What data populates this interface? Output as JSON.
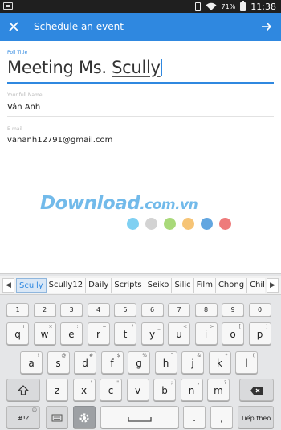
{
  "status_bar": {
    "battery_percent": "71%",
    "time": "11:38"
  },
  "app_bar": {
    "title": "Schedule an event",
    "close_icon": "close-icon",
    "next_icon": "arrow-right-icon"
  },
  "form": {
    "poll_title": {
      "label": "Poll Title",
      "value_prefix": "Meeting Ms. ",
      "value_underlined": "Scully"
    },
    "full_name": {
      "label": "Your full Name",
      "value": "Vân Anh"
    },
    "email": {
      "label": "E-mail",
      "value": "vananh12791@gmail.com"
    }
  },
  "watermark": {
    "main": "Download",
    "suffix": ".com.vn",
    "dot_colors": [
      "#7fd0f2",
      "#d3d3d3",
      "#a9d97a",
      "#f6c476",
      "#62a6e0",
      "#ee7b7b"
    ]
  },
  "keyboard": {
    "suggestions": [
      "Scully",
      "Scully12",
      "Daily",
      "Scripts",
      "Seiko",
      "Silic",
      "Film",
      "Chong",
      "Chile"
    ],
    "number_row": [
      "1",
      "2",
      "3",
      "4",
      "5",
      "6",
      "7",
      "8",
      "9",
      "0"
    ],
    "row1": [
      {
        "key": "q",
        "alt": "+"
      },
      {
        "key": "w",
        "alt": "×"
      },
      {
        "key": "e",
        "alt": "÷"
      },
      {
        "key": "r",
        "alt": "="
      },
      {
        "key": "t",
        "alt": "/"
      },
      {
        "key": "y",
        "alt": "_"
      },
      {
        "key": "u",
        "alt": "<"
      },
      {
        "key": "i",
        "alt": ">"
      },
      {
        "key": "o",
        "alt": "["
      },
      {
        "key": "p",
        "alt": "]"
      }
    ],
    "row2": [
      {
        "key": "a",
        "alt": "!"
      },
      {
        "key": "s",
        "alt": "@"
      },
      {
        "key": "d",
        "alt": "#"
      },
      {
        "key": "f",
        "alt": "$"
      },
      {
        "key": "g",
        "alt": "%"
      },
      {
        "key": "h",
        "alt": "^"
      },
      {
        "key": "j",
        "alt": "&"
      },
      {
        "key": "k",
        "alt": "*"
      },
      {
        "key": "l",
        "alt": "("
      }
    ],
    "row3": [
      {
        "key": "z",
        "alt": "-"
      },
      {
        "key": "x",
        "alt": "'"
      },
      {
        "key": "c",
        "alt": "\""
      },
      {
        "key": "v",
        "alt": ":"
      },
      {
        "key": "b",
        "alt": ";"
      },
      {
        "key": "n",
        "alt": ","
      },
      {
        "key": "m",
        "alt": "?"
      }
    ],
    "sym_key": "#!?",
    "period_key": ".",
    "comma_key": ",",
    "enter_key": "Tiếp theo"
  }
}
